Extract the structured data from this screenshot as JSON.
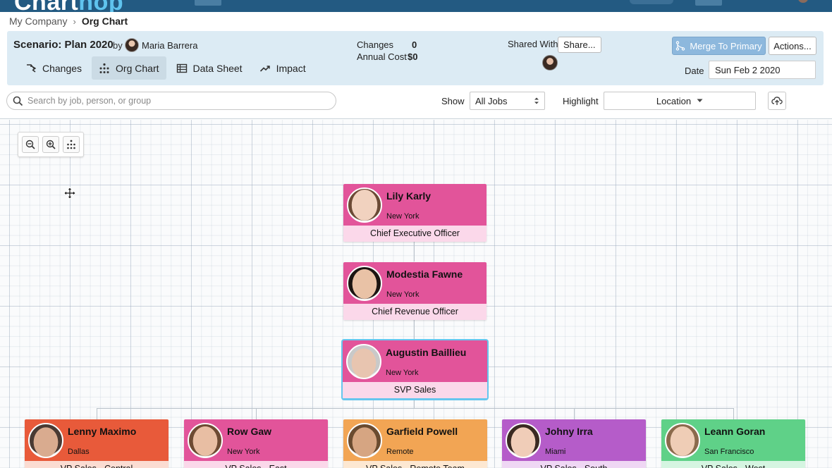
{
  "app": {
    "logo_main": "Chart",
    "logo_accent": "hop"
  },
  "breadcrumb": {
    "root": "My Company",
    "separator": "›",
    "current": "Org Chart"
  },
  "scenario": {
    "title": "Scenario: Plan 2020",
    "by_label": "by",
    "owner": "Maria Barrera",
    "tabs": [
      {
        "label": "Changes",
        "icon": "changes-icon",
        "active": false
      },
      {
        "label": "Org Chart",
        "icon": "org-chart-icon",
        "active": true
      },
      {
        "label": "Data Sheet",
        "icon": "data-sheet-icon",
        "active": false
      },
      {
        "label": "Impact",
        "icon": "impact-icon",
        "active": false
      }
    ],
    "stats": {
      "changes_label": "Changes",
      "changes_value": "0",
      "cost_label": "Annual Cost",
      "cost_value": "$0"
    },
    "shared_with_label": "Shared With",
    "share_button": "Share...",
    "merge_button": "Merge To Primary",
    "actions_button": "Actions...",
    "date_label": "Date",
    "date_value": "Sun Feb 2 2020"
  },
  "toolbar": {
    "search_placeholder": "Search by job, person, or group",
    "show_label": "Show",
    "show_value": "All Jobs",
    "highlight_label": "Highlight",
    "highlight_value": "Location"
  },
  "colors": {
    "header_bg": "#235a82",
    "scenario_bg": "#dcebf4",
    "merge_btn": "#8db8dd",
    "card_pink": "#e2549a",
    "card_red": "#e85a3a",
    "card_orange": "#f2a554",
    "card_purple": "#b55cc9",
    "card_green": "#5fd188",
    "selected_outline": "#66c6ee"
  },
  "org": {
    "ceo": {
      "name": "Lily Karly",
      "location": "New York",
      "title": "Chief Executive Officer"
    },
    "cro": {
      "name": "Modestia Fawne",
      "location": "New York",
      "title": "Chief Revenue Officer"
    },
    "svp": {
      "name": "Augustin Baillieu",
      "location": "New York",
      "title": "SVP Sales"
    },
    "vps": [
      {
        "name": "Lenny Maximo",
        "location": "Dallas",
        "title": "VP Sales - Central"
      },
      {
        "name": "Row Gaw",
        "location": "New York",
        "title": "VP Sales - East"
      },
      {
        "name": "Garfield Powell",
        "location": "Remote",
        "title": "VP Sales - Remote Team"
      },
      {
        "name": "Johny Irra",
        "location": "Miami",
        "title": "VP Sales - South"
      },
      {
        "name": "Leann Goran",
        "location": "San Francisco",
        "title": "VP Sales - West"
      }
    ]
  }
}
